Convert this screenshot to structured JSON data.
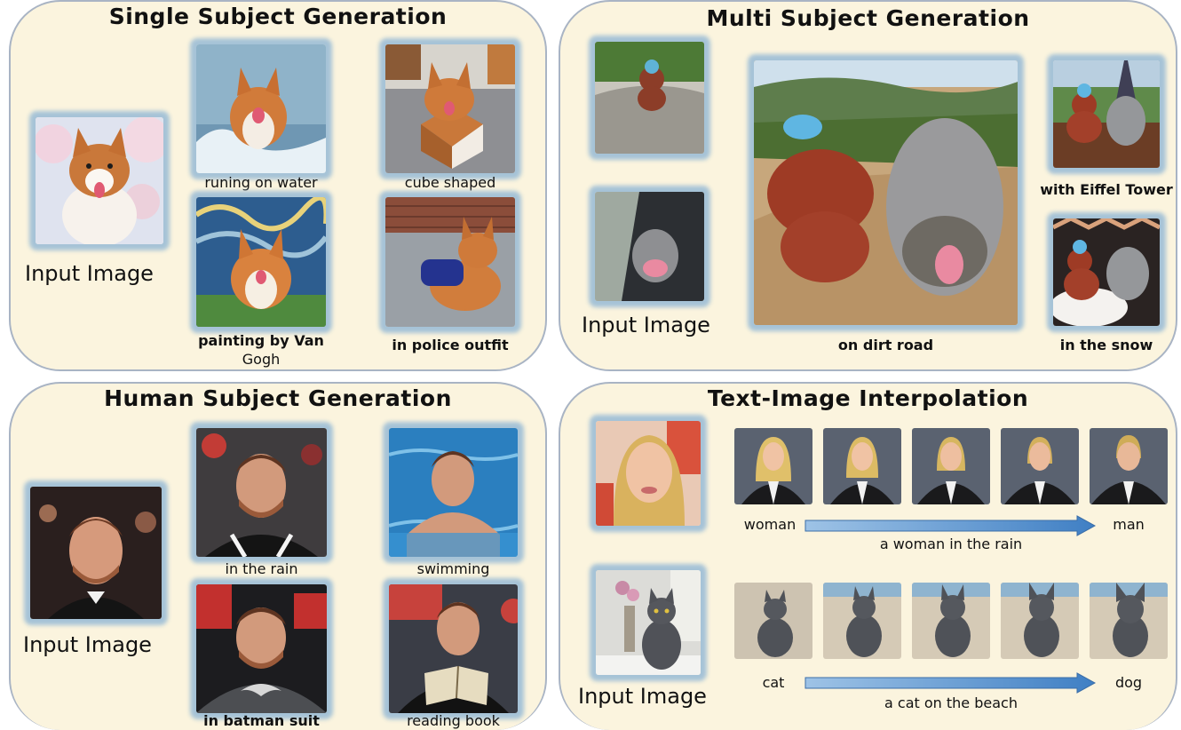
{
  "single": {
    "title": "Single Subject Generation",
    "input_label": "Input Image",
    "captions": [
      "runing on water",
      "cube shaped",
      "painting by Van",
      "Gogh",
      "in police outfit"
    ]
  },
  "multi": {
    "title": "Multi Subject Generation",
    "input_label": "Input Image",
    "captions": [
      "on dirt road",
      "with Eiffel Tower",
      "in the snow"
    ]
  },
  "human": {
    "title": "Human Subject Generation",
    "input_label": "Input Image",
    "captions": [
      "in the rain",
      "swimming",
      "in batman suit",
      "reading book"
    ]
  },
  "interp": {
    "title": "Text-Image Interpolation",
    "input_label": "Input Image",
    "row1": {
      "from": "woman",
      "to": "man",
      "prompt": "a woman in the rain"
    },
    "row2": {
      "from": "cat",
      "to": "dog",
      "prompt": "a cat on the beach"
    }
  },
  "colors": {
    "panel_bg": "#fbf4de",
    "panel_border": "#a9b4c4",
    "glow": "#9cbed6",
    "arrow": "#4a86c8"
  }
}
